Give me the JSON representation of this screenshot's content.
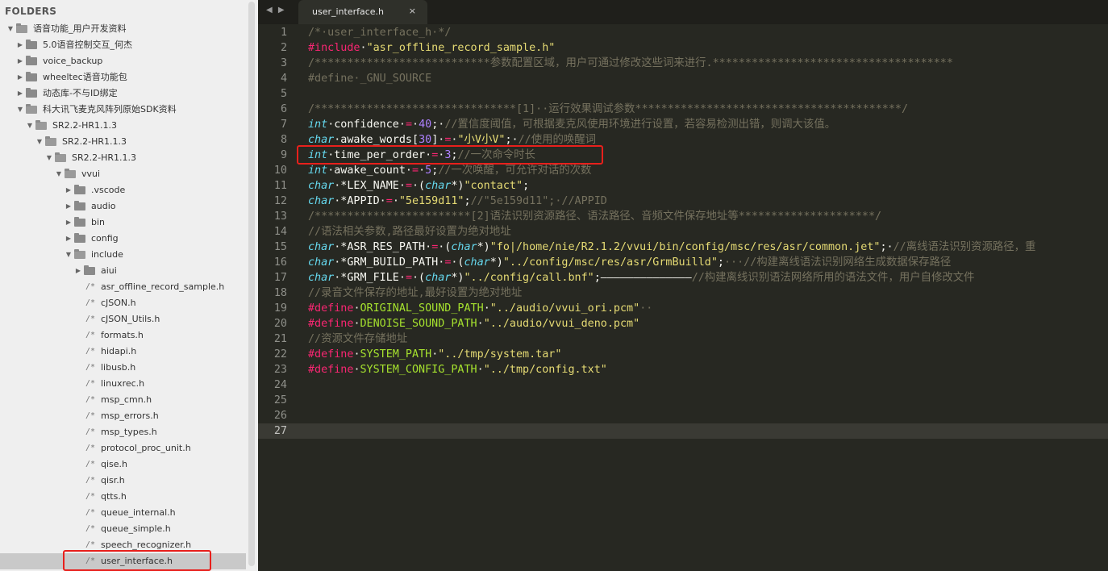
{
  "sidebar": {
    "title": "FOLDERS",
    "tree": [
      {
        "label": "语音功能_用户开发资料",
        "depth": 0,
        "type": "folder",
        "open": true
      },
      {
        "label": "5.0语音控制交互_何杰",
        "depth": 1,
        "type": "folder",
        "open": false
      },
      {
        "label": "voice_backup",
        "depth": 1,
        "type": "folder",
        "open": false
      },
      {
        "label": "wheeltec语音功能包",
        "depth": 1,
        "type": "folder",
        "open": false
      },
      {
        "label": "动态库-不与ID绑定",
        "depth": 1,
        "type": "folder",
        "open": false
      },
      {
        "label": "科大讯飞麦克风阵列原始SDK资料",
        "depth": 1,
        "type": "folder",
        "open": true
      },
      {
        "label": "SR2.2-HR1.1.3",
        "depth": 2,
        "type": "folder",
        "open": true
      },
      {
        "label": "SR2.2-HR1.1.3",
        "depth": 3,
        "type": "folder",
        "open": true
      },
      {
        "label": "SR2.2-HR1.1.3",
        "depth": 4,
        "type": "folder",
        "open": true
      },
      {
        "label": "vvui",
        "depth": 5,
        "type": "folder",
        "open": true
      },
      {
        "label": ".vscode",
        "depth": 6,
        "type": "folder",
        "open": false
      },
      {
        "label": "audio",
        "depth": 6,
        "type": "folder",
        "open": false
      },
      {
        "label": "bin",
        "depth": 6,
        "type": "folder",
        "open": false
      },
      {
        "label": "config",
        "depth": 6,
        "type": "folder",
        "open": false
      },
      {
        "label": "include",
        "depth": 6,
        "type": "folder",
        "open": true
      },
      {
        "label": "aiui",
        "depth": 7,
        "type": "folder",
        "open": false
      },
      {
        "label": "asr_offline_record_sample.h",
        "depth": 7,
        "type": "file"
      },
      {
        "label": "cJSON.h",
        "depth": 7,
        "type": "file"
      },
      {
        "label": "cJSON_Utils.h",
        "depth": 7,
        "type": "file"
      },
      {
        "label": "formats.h",
        "depth": 7,
        "type": "file"
      },
      {
        "label": "hidapi.h",
        "depth": 7,
        "type": "file"
      },
      {
        "label": "libusb.h",
        "depth": 7,
        "type": "file"
      },
      {
        "label": "linuxrec.h",
        "depth": 7,
        "type": "file"
      },
      {
        "label": "msp_cmn.h",
        "depth": 7,
        "type": "file"
      },
      {
        "label": "msp_errors.h",
        "depth": 7,
        "type": "file"
      },
      {
        "label": "msp_types.h",
        "depth": 7,
        "type": "file"
      },
      {
        "label": "protocol_proc_unit.h",
        "depth": 7,
        "type": "file"
      },
      {
        "label": "qise.h",
        "depth": 7,
        "type": "file"
      },
      {
        "label": "qisr.h",
        "depth": 7,
        "type": "file"
      },
      {
        "label": "qtts.h",
        "depth": 7,
        "type": "file"
      },
      {
        "label": "queue_internal.h",
        "depth": 7,
        "type": "file"
      },
      {
        "label": "queue_simple.h",
        "depth": 7,
        "type": "file"
      },
      {
        "label": "speech_recognizer.h",
        "depth": 7,
        "type": "file"
      },
      {
        "label": "user_interface.h",
        "depth": 7,
        "type": "file",
        "selected": true
      }
    ],
    "file_icon_text": "/*"
  },
  "tabbar": {
    "nav_back": "◀",
    "nav_forward": "▶",
    "active_tab": "user_interface.h",
    "close_icon": "×"
  },
  "editor": {
    "current_line": 27,
    "lines": [
      {
        "n": "1",
        "tokens": [
          [
            "c",
            "/*·user_interface_h·*/"
          ]
        ]
      },
      {
        "n": "2",
        "tokens": [
          [
            "pre",
            "#include"
          ],
          [
            "p",
            "·"
          ],
          [
            "s",
            "\"asr_offline_record_sample.h\""
          ]
        ]
      },
      {
        "n": "3",
        "tokens": [
          [
            "c",
            "/***************************参数配置区域，用户可通过修改这些词来进行.*************************************"
          ]
        ]
      },
      {
        "n": "4",
        "tokens": [
          [
            "c",
            "#define·_GNU_SOURCE"
          ]
        ]
      },
      {
        "n": "5",
        "tokens": []
      },
      {
        "n": "6",
        "tokens": [
          [
            "c",
            "/*******************************[1]··运行效果调试参数*****************************************/"
          ]
        ]
      },
      {
        "n": "7",
        "tokens": [
          [
            "k",
            "int"
          ],
          [
            "p",
            "·confidence·"
          ],
          [
            "o",
            "="
          ],
          [
            "p",
            "·"
          ],
          [
            "num",
            "40"
          ],
          [
            "p",
            ";·"
          ],
          [
            "c",
            "//置信度阈值，可根据麦克风使用环境进行设置，若容易检测出错，则调大该值。"
          ]
        ]
      },
      {
        "n": "8",
        "tokens": [
          [
            "k",
            "char"
          ],
          [
            "p",
            "·awake_words["
          ],
          [
            "num",
            "30"
          ],
          [
            "p",
            "]·"
          ],
          [
            "o",
            "="
          ],
          [
            "p",
            "·"
          ],
          [
            "s",
            "\"小V小V\""
          ],
          [
            "p",
            ";·"
          ],
          [
            "c",
            "//使用的唤醒词"
          ]
        ]
      },
      {
        "n": "9",
        "tokens": [
          [
            "k",
            "int"
          ],
          [
            "p",
            "·time_per_order·"
          ],
          [
            "o",
            "="
          ],
          [
            "p",
            "·"
          ],
          [
            "num",
            "3"
          ],
          [
            "p",
            ";"
          ],
          [
            "c",
            "//一次命令时长"
          ]
        ]
      },
      {
        "n": "10",
        "tokens": [
          [
            "k",
            "int"
          ],
          [
            "p",
            "·awake_count·"
          ],
          [
            "o",
            "="
          ],
          [
            "p",
            "·"
          ],
          [
            "num",
            "5"
          ],
          [
            "p",
            ";"
          ],
          [
            "c",
            "//一次唤醒，可允许对话的次数"
          ]
        ]
      },
      {
        "n": "11",
        "tokens": [
          [
            "k",
            "char"
          ],
          [
            "p",
            "·*LEX_NAME·"
          ],
          [
            "o",
            "="
          ],
          [
            "p",
            "·("
          ],
          [
            "k",
            "char"
          ],
          [
            "p",
            "*)"
          ],
          [
            "s",
            "\"contact\""
          ],
          [
            "p",
            ";"
          ]
        ]
      },
      {
        "n": "12",
        "tokens": [
          [
            "k",
            "char"
          ],
          [
            "p",
            "·*APPID·"
          ],
          [
            "o",
            "="
          ],
          [
            "p",
            "·"
          ],
          [
            "s",
            "\"5e159d11\""
          ],
          [
            "p",
            ";"
          ],
          [
            "c",
            "//\"5e159d11\";·//APPID"
          ]
        ]
      },
      {
        "n": "13",
        "tokens": [
          [
            "c",
            "/************************[2]语法识别资源路径、语法路径、音频文件保存地址等*********************/"
          ]
        ]
      },
      {
        "n": "14",
        "tokens": [
          [
            "c",
            "//语法相关参数,路径最好设置为绝对地址"
          ]
        ]
      },
      {
        "n": "15",
        "tokens": [
          [
            "k",
            "char"
          ],
          [
            "p",
            "·*ASR_RES_PATH·"
          ],
          [
            "o",
            "="
          ],
          [
            "p",
            "·("
          ],
          [
            "k",
            "char"
          ],
          [
            "p",
            "*)"
          ],
          [
            "s",
            "\"fo|/home/nie/R2.1.2/vvui/bin/config/msc/res/asr/common.jet\""
          ],
          [
            "p",
            ";·"
          ],
          [
            "c",
            "//离线语法识别资源路径，重"
          ]
        ]
      },
      {
        "n": "16",
        "tokens": [
          [
            "k",
            "char"
          ],
          [
            "p",
            "·*GRM_BUILD_PATH·"
          ],
          [
            "o",
            "="
          ],
          [
            "p",
            "·("
          ],
          [
            "k",
            "char"
          ],
          [
            "p",
            "*)"
          ],
          [
            "s",
            "\"../config/msc/res/asr/GrmBuilld\""
          ],
          [
            "p",
            ";"
          ],
          [
            "c",
            "···//构建离线语法识别网络生成数据保存路径"
          ]
        ]
      },
      {
        "n": "17",
        "tokens": [
          [
            "k",
            "char"
          ],
          [
            "p",
            "·*GRM_FILE·"
          ],
          [
            "o",
            "="
          ],
          [
            "p",
            "·("
          ],
          [
            "k",
            "char"
          ],
          [
            "p",
            "*)"
          ],
          [
            "s",
            "\"../config/call.bnf\""
          ],
          [
            "p",
            ";——————————————"
          ],
          [
            "c",
            "//构建离线识别语法网络所用的语法文件，用户自修改文件"
          ]
        ]
      },
      {
        "n": "18",
        "tokens": [
          [
            "c",
            "//录音文件保存的地址,最好设置为绝对地址"
          ]
        ]
      },
      {
        "n": "19",
        "tokens": [
          [
            "pre",
            "#define"
          ],
          [
            "p",
            "·"
          ],
          [
            "m",
            "ORIGINAL_SOUND_PATH"
          ],
          [
            "p",
            "·"
          ],
          [
            "s",
            "\"../audio/vvui_ori.pcm\""
          ],
          [
            "c",
            "··"
          ]
        ]
      },
      {
        "n": "20",
        "tokens": [
          [
            "pre",
            "#define"
          ],
          [
            "p",
            "·"
          ],
          [
            "m",
            "DENOISE_SOUND_PATH"
          ],
          [
            "p",
            "·"
          ],
          [
            "s",
            "\"../audio/vvui_deno.pcm\""
          ]
        ]
      },
      {
        "n": "21",
        "tokens": [
          [
            "c",
            "//资源文件存储地址"
          ]
        ]
      },
      {
        "n": "22",
        "tokens": [
          [
            "pre",
            "#define"
          ],
          [
            "p",
            "·"
          ],
          [
            "m",
            "SYSTEM_PATH"
          ],
          [
            "p",
            "·"
          ],
          [
            "s",
            "\"../tmp/system.tar\""
          ]
        ]
      },
      {
        "n": "23",
        "tokens": [
          [
            "pre",
            "#define"
          ],
          [
            "p",
            "·"
          ],
          [
            "m",
            "SYSTEM_CONFIG_PATH"
          ],
          [
            "p",
            "·"
          ],
          [
            "s",
            "\"../tmp/config.txt\""
          ]
        ]
      },
      {
        "n": "24",
        "tokens": []
      },
      {
        "n": "25",
        "tokens": []
      },
      {
        "n": "26",
        "tokens": []
      },
      {
        "n": "27",
        "tokens": []
      }
    ]
  },
  "colors": {
    "editor_bg": "#272822",
    "sidebar_bg": "#efefef",
    "highlight_box": "#e8201c",
    "comment": "#75715e",
    "keyword": "#66d9ef",
    "string": "#e6db74",
    "number": "#ae81ff",
    "preprocessor": "#f92672",
    "macro": "#a6e22e"
  }
}
